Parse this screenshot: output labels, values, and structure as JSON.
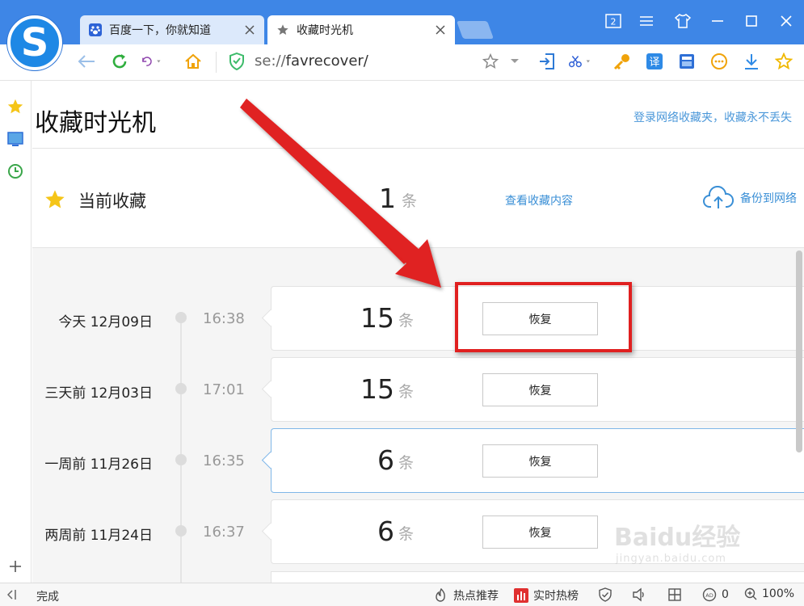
{
  "browser": {
    "tabs": [
      {
        "title": "百度一下，你就知道",
        "icon": "baidu-paw-icon",
        "active": false
      },
      {
        "title": "收藏时光机",
        "icon": "star-icon",
        "active": true
      }
    ],
    "tab_count_badge": "2",
    "address": {
      "scheme": "se://",
      "path": "favrecover/"
    },
    "accent_color": "#3e86e6"
  },
  "page": {
    "title": "收藏时光机",
    "login_link": "登录网络收藏夹，收藏永不丢失",
    "current": {
      "label": "当前收藏",
      "count": "1",
      "unit": "条",
      "view_link": "查看收藏内容",
      "backup_label": "备份到网络"
    },
    "entries": [
      {
        "date": "今天  12月09日",
        "time": "16:38",
        "count": "15",
        "unit": "条",
        "button": "恢复",
        "highlighted": false
      },
      {
        "date": "三天前  12月03日",
        "time": "17:01",
        "count": "15",
        "unit": "条",
        "button": "恢复",
        "highlighted": false
      },
      {
        "date": "一周前  11月26日",
        "time": "16:35",
        "count": "6",
        "unit": "条",
        "button": "恢复",
        "highlighted": true
      },
      {
        "date": "两周前  11月24日",
        "time": "16:37",
        "count": "6",
        "unit": "条",
        "button": "恢复",
        "highlighted": false
      }
    ]
  },
  "statusbar": {
    "status": "完成",
    "hot_recommend": "热点推荐",
    "realtime_ranking": "实时热榜",
    "adblock_count": "0",
    "zoom": "100%"
  },
  "watermark": {
    "brand": "Baidu经验",
    "sub": "jingyan.baidu.com"
  }
}
